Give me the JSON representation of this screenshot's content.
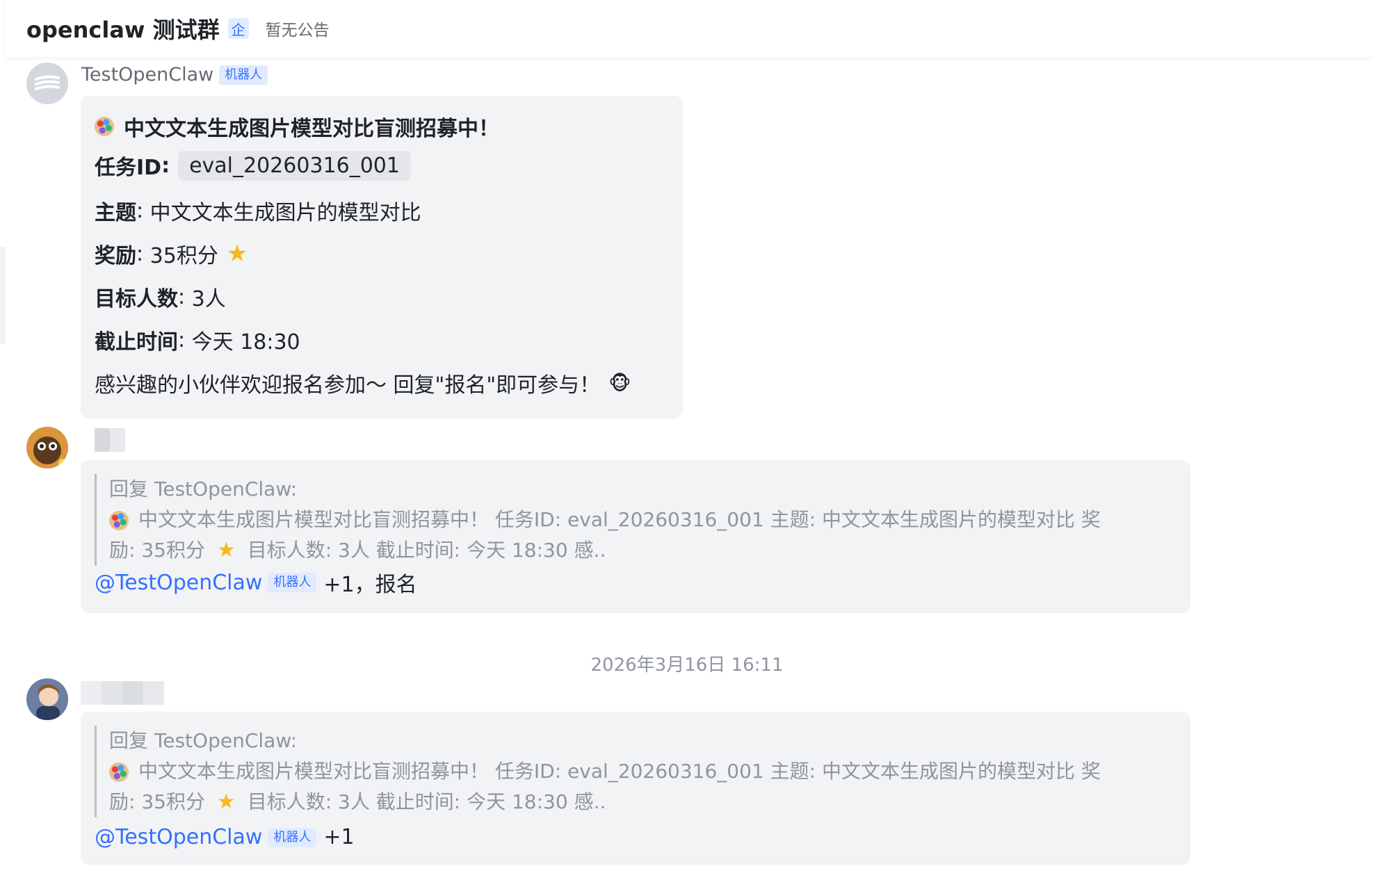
{
  "header": {
    "group_name": "openclaw 测试群",
    "enterprise_badge": "企",
    "announcement": "暂无公告"
  },
  "messages": [
    {
      "sender": "TestOpenClaw",
      "bot_tag": "机器人",
      "title": "中文文本生成图片模型对比盲测招募中！",
      "task_key": "任务ID",
      "task_id": "eval_20260316_001",
      "topic_key": "主题",
      "topic": "中文文本生成图片的模型对比",
      "reward_key": "奖励",
      "reward": "35积分",
      "target_key": "目标人数",
      "target": "3人",
      "deadline_key": "截止时间",
      "deadline": "今天 18:30",
      "cta": "感兴趣的小伙伴欢迎报名参加～ 回复\"报名\"即可参与！",
      "title_icon": "palette-icon",
      "reward_icon": "star-icon",
      "cta_icon": "monkey-icon"
    },
    {
      "quote_head": "回复 TestOpenClaw:",
      "quote_body_1": "中文文本生成图片模型对比盲测招募中！ 任务ID: eval_20260316_001 主题: 中文文本生成图片的模型对比 奖",
      "quote_body_2_a": "励: 35积分",
      "quote_body_2_b": "目标人数: 3人 截止时间: 今天 18:30 感..",
      "mention": "@TestOpenClaw",
      "bot_tag": "机器人",
      "reply": "+1，报名"
    },
    {
      "quote_head": "回复 TestOpenClaw:",
      "quote_body_1": "中文文本生成图片模型对比盲测招募中！ 任务ID: eval_20260316_001 主题: 中文文本生成图片的模型对比 奖",
      "quote_body_2_a": "励: 35积分",
      "quote_body_2_b": "目标人数: 3人 截止时间: 今天 18:30 感..",
      "mention": "@TestOpenClaw",
      "bot_tag": "机器人",
      "reply": "+1"
    }
  ],
  "timestamp": "2026年3月16日 16:11",
  "colors": {
    "accent": "#3370ff",
    "bubble": "#f2f3f5",
    "muted_text": "#8f959e",
    "star": "#f7ba1e"
  }
}
